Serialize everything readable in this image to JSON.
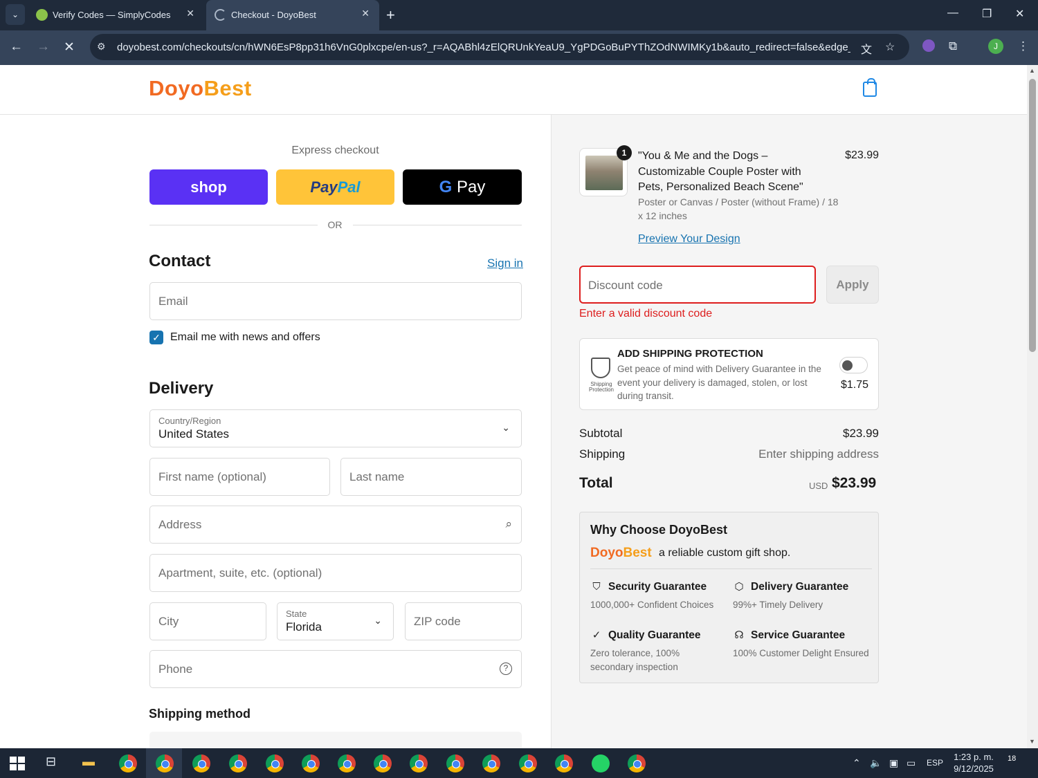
{
  "browser": {
    "tabs": [
      {
        "title": "Verify Codes — SimplyCodes"
      },
      {
        "title": "Checkout - DoyoBest"
      }
    ],
    "url": "doyobest.com/checkouts/cn/hWN6EsP8pp31h6VnG0plxcpe/en-us?_r=AQABhl4zElQRUnkYeaU9_YgPDGoBuPYThZOdNWIMKy1b&auto_redirect=false&edge_re...",
    "profile_initial": "J"
  },
  "header": {
    "logo_part1": "Doyo",
    "logo_part2": "Best"
  },
  "checkout": {
    "express_label": "Express checkout",
    "shop_label": "shop",
    "paypal_part1": "Pay",
    "paypal_part2": "Pal",
    "gpay_g": "G",
    "gpay_label": "Pay",
    "or_label": "OR",
    "contact_title": "Contact",
    "signin_label": "Sign in",
    "email_placeholder": "Email",
    "news_label": "Email me with news and offers",
    "delivery_title": "Delivery",
    "country_label": "Country/Region",
    "country_value": "United States",
    "first_name_placeholder": "First name (optional)",
    "last_name_placeholder": "Last name",
    "address_placeholder": "Address",
    "apartment_placeholder": "Apartment, suite, etc. (optional)",
    "city_placeholder": "City",
    "state_label": "State",
    "state_value": "Florida",
    "zip_placeholder": "ZIP code",
    "phone_placeholder": "Phone",
    "shipping_method_title": "Shipping method"
  },
  "summary": {
    "quantity": "1",
    "product_title": "\"You & Me and the Dogs – Customizable Couple Poster with Pets, Personalized Beach Scene\"",
    "product_variant": "Poster or Canvas / Poster (without Frame) / 18 x 12 inches",
    "product_price": "$23.99",
    "preview_link": "Preview Your Design",
    "discount_placeholder": "Discount code",
    "apply_label": "Apply",
    "discount_error": "Enter a valid discount code",
    "protection_title": "ADD SHIPPING PROTECTION",
    "protection_desc": "Get peace of mind with Delivery Guarantee in the event your delivery is damaged, stolen, or lost during transit.",
    "protection_icon_caption": "Shipping Protection",
    "protection_price": "$1.75",
    "protection_enabled": false,
    "subtotal_label": "Subtotal",
    "subtotal_value": "$23.99",
    "shipping_label": "Shipping",
    "shipping_value": "Enter shipping address",
    "total_label": "Total",
    "total_currency": "USD",
    "total_value": "$23.99"
  },
  "why": {
    "title": "Why Choose DoyoBest",
    "logo_part1": "Doyo",
    "logo_part2": "Best",
    "tagline": "a reliable custom gift shop.",
    "guarantees": [
      {
        "title": "Security Guarantee",
        "desc": "1000,000+ Confident Choices",
        "icon": "shield-check-icon"
      },
      {
        "title": "Delivery Guarantee",
        "desc": "99%+ Timely Delivery",
        "icon": "package-icon"
      },
      {
        "title": "Quality Guarantee",
        "desc": "Zero tolerance, 100% secondary inspection",
        "icon": "check-circle-icon"
      },
      {
        "title": "Service Guarantee",
        "desc": "100% Customer Delight Ensured",
        "icon": "headset-icon"
      }
    ]
  },
  "taskbar": {
    "language": "ESP",
    "time": "1:23 p. m.",
    "date": "9/12/2025",
    "notifications": "18"
  },
  "colors": {
    "brand_orange": "#f16a22",
    "link_blue": "#1773b0",
    "error_red": "#dd1d1d",
    "shop_purple": "#5a31f4",
    "paypal_yellow": "#ffc439"
  }
}
